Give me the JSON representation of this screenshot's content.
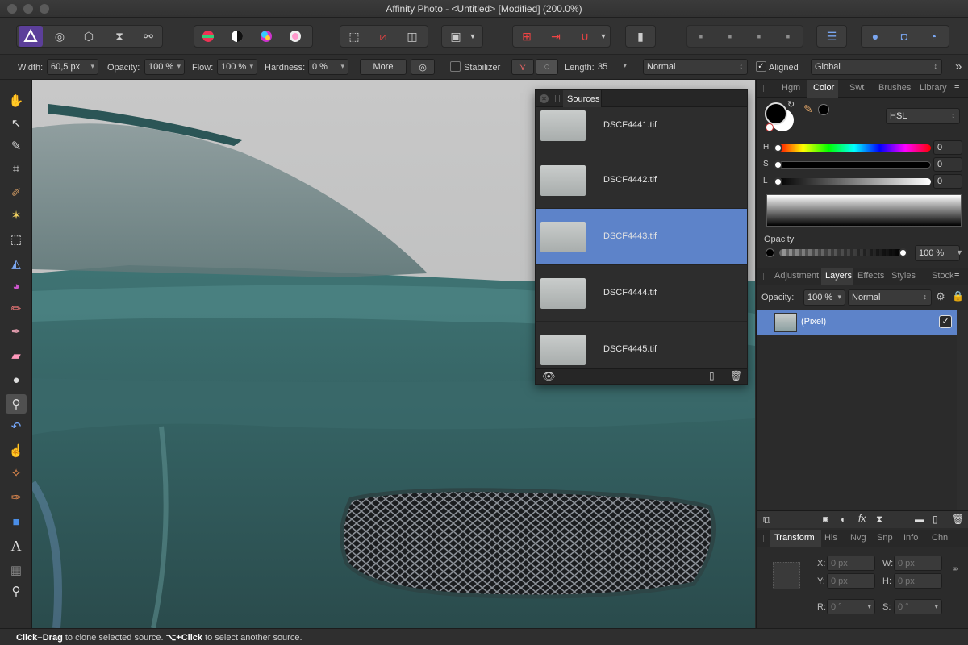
{
  "window": {
    "title": "Affinity Photo - <Untitled> [Modified] (200.0%)"
  },
  "colors": {
    "accent": "#5d83c9",
    "background": "#2b2b2b",
    "canvas": "#4f7f7f"
  },
  "context_toolbar": {
    "width_label": "Width:",
    "width_value": "60,5 px",
    "opacity_label": "Opacity:",
    "opacity_value": "100 %",
    "flow_label": "Flow:",
    "flow_value": "100 %",
    "hardness_label": "Hardness:",
    "hardness_value": "0 %",
    "more_label": "More",
    "stabilizer_label": "Stabilizer",
    "length_label": "Length:",
    "length_value": "35",
    "blend_mode": "Normal",
    "aligned_label": "Aligned",
    "global_value": "Global"
  },
  "sources_panel": {
    "title": "Sources",
    "items": [
      {
        "name": "DSCF4441.tif",
        "selected": false
      },
      {
        "name": "DSCF4442.tif",
        "selected": false
      },
      {
        "name": "DSCF4443.tif",
        "selected": true
      },
      {
        "name": "DSCF4444.tif",
        "selected": false
      },
      {
        "name": "DSCF4445.tif",
        "selected": false
      }
    ]
  },
  "color_panel": {
    "tabs": [
      "Hgm",
      "Color",
      "Swt",
      "Brushes",
      "Library"
    ],
    "active_tab": "Color",
    "model": "HSL",
    "h_label": "H",
    "h_value": "0",
    "s_label": "S",
    "s_value": "0",
    "l_label": "L",
    "l_value": "0",
    "opacity_label": "Opacity",
    "opacity_value": "100 %"
  },
  "layers_panel": {
    "tabs": [
      "Adjustment",
      "Layers",
      "Effects",
      "Styles",
      "Stock"
    ],
    "active_tab": "Layers",
    "opacity_label": "Opacity:",
    "opacity_value": "100 %",
    "blend_mode": "Normal",
    "layer_name": "(Pixel)"
  },
  "transform_panel": {
    "tabs": [
      "Transform",
      "His",
      "Nvg",
      "Snp",
      "Info",
      "Chn"
    ],
    "active_tab": "Transform",
    "x_label": "X:",
    "x_placeholder": "0 px",
    "y_label": "Y:",
    "y_placeholder": "0 px",
    "w_label": "W:",
    "w_placeholder": "0 px",
    "h_label": "H:",
    "h_placeholder": "0 px",
    "r_label": "R:",
    "r_placeholder": "0 °",
    "s_label": "S:",
    "s_placeholder": "0 °"
  },
  "status_bar": {
    "part1": "Click",
    "part2": "+",
    "part3": "Drag",
    "part4": " to clone selected source. ",
    "part5": "⌥+Click",
    "part6": " to select another source."
  }
}
